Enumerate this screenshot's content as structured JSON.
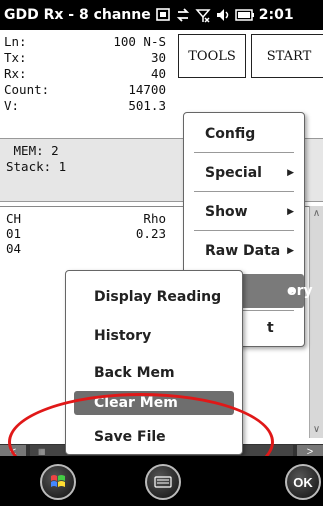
{
  "statusbar": {
    "title": "GDD Rx - 8 channe",
    "clock": "2:01",
    "icons": [
      "windows-switch-icon",
      "sync-icon",
      "no-signal-icon",
      "speaker-icon",
      "battery-icon"
    ]
  },
  "info": {
    "rows": [
      {
        "label": "Ln:",
        "value": "100 N-S"
      },
      {
        "label": "Tx:",
        "value": "30"
      },
      {
        "label": "Rx:",
        "value": "40"
      },
      {
        "label": "Count:",
        "value": "14700"
      },
      {
        "label": "V:",
        "value": "501.3"
      }
    ]
  },
  "toolbar": {
    "tools_label": "TOOLS",
    "start_label": "START"
  },
  "mem": {
    "mem_line": " MEM: 2",
    "stack_line": "Stack: 1"
  },
  "table": {
    "headers": [
      "CH",
      "Rho",
      ""
    ],
    "rows": [
      [
        "01",
        "0.23",
        ""
      ],
      [
        "04",
        "",
        ""
      ]
    ]
  },
  "main_menu": {
    "items": [
      {
        "label": "Config",
        "submenu": false
      },
      {
        "label": "Special",
        "submenu": true
      },
      {
        "label": "Show",
        "submenu": true
      },
      {
        "label": "Raw Data",
        "submenu": true
      },
      {
        "label": "ory",
        "submenu": true
      },
      {
        "label": "t",
        "submenu": false
      }
    ]
  },
  "sub_menu": {
    "items": [
      {
        "label": "Display Reading"
      },
      {
        "label": "History"
      },
      {
        "label": "Back Mem"
      },
      {
        "label": "Clear Mem"
      },
      {
        "label": "Save File"
      }
    ]
  },
  "softkeys": {
    "ok_label": "OK"
  },
  "colors": {
    "highlight_ring": "#e01818",
    "menu_active": "#7a7a7a"
  }
}
